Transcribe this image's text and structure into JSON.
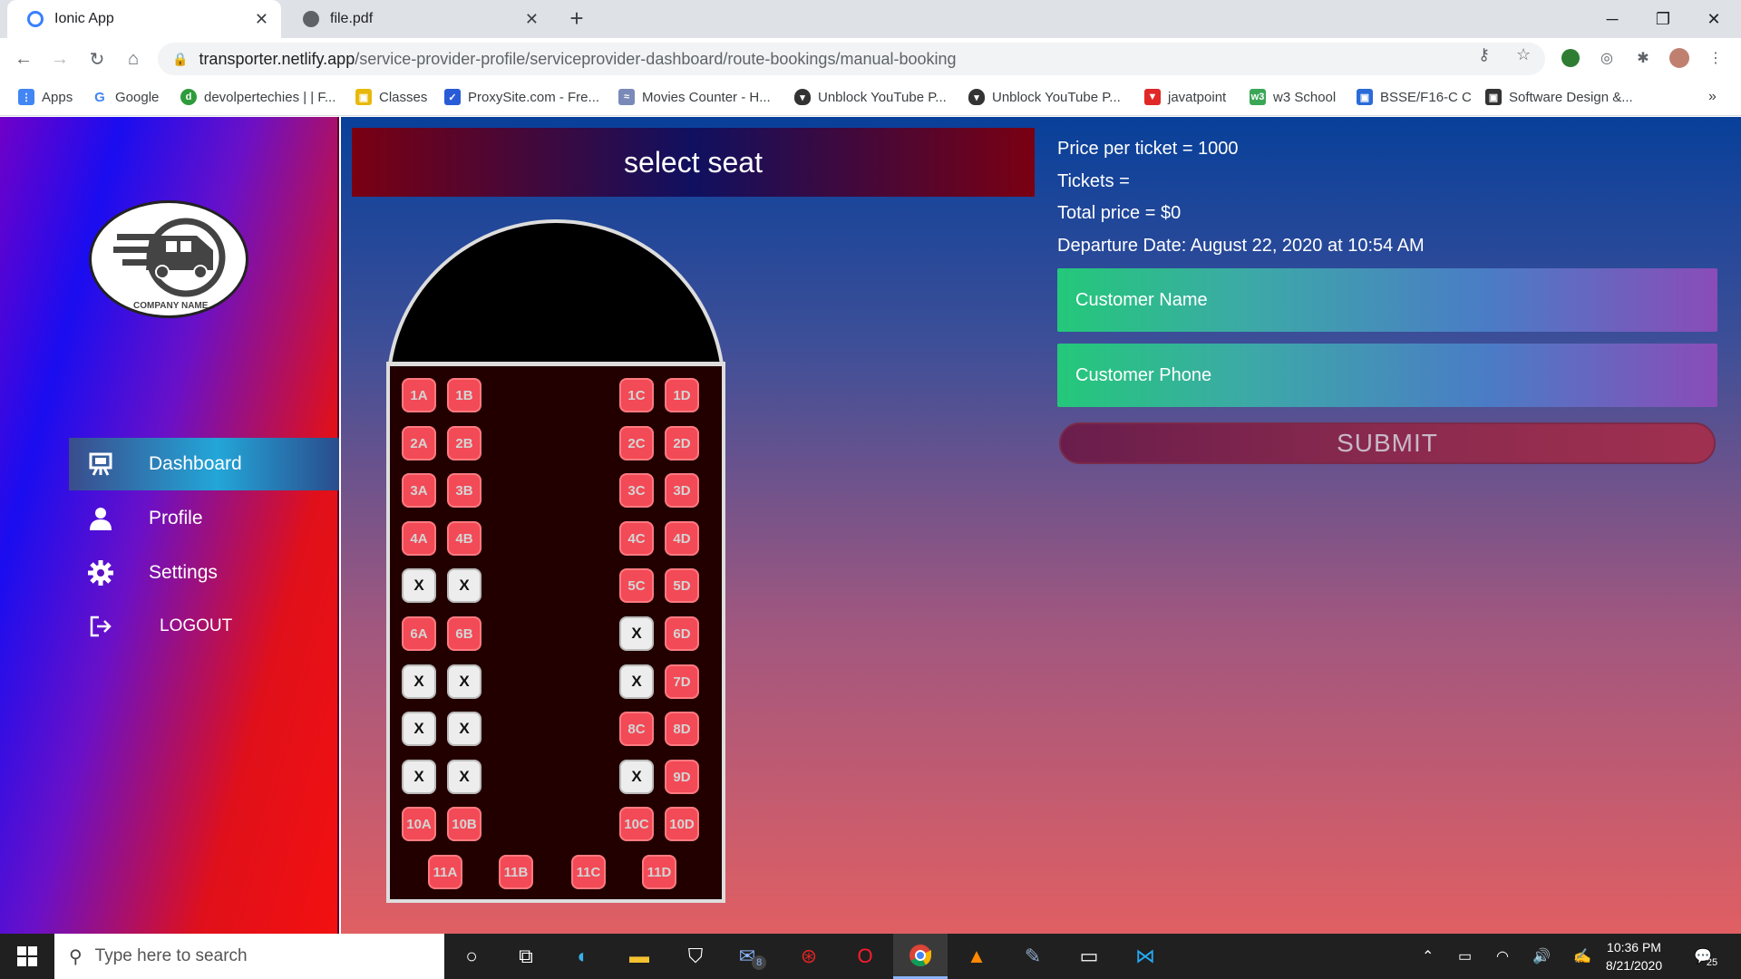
{
  "browser": {
    "tabs": [
      {
        "title": "Ionic App",
        "icon": "ionic-icon"
      },
      {
        "title": "file.pdf",
        "icon": "globe-icon"
      }
    ],
    "url_host": "transporter.netlify.app",
    "url_path": "/service-provider-profile/serviceprovider-dashboard/route-bookings/manual-booking",
    "bookmarks": [
      {
        "label": "Apps",
        "icon": "apps-grid-icon"
      },
      {
        "label": "Google",
        "icon": "google-icon"
      },
      {
        "label": "devolpertechies | | F...",
        "icon": "devolper-icon"
      },
      {
        "label": "Classes",
        "icon": "classes-icon"
      },
      {
        "label": "ProxySite.com - Fre...",
        "icon": "shield-icon"
      },
      {
        "label": "Movies Counter - H...",
        "icon": "movies-icon"
      },
      {
        "label": "Unblock YouTube P...",
        "icon": "shield-icon"
      },
      {
        "label": "Unblock YouTube P...",
        "icon": "shield-icon"
      },
      {
        "label": "javatpoint",
        "icon": "javatpoint-icon"
      },
      {
        "label": "w3 School",
        "icon": "w3-icon"
      },
      {
        "label": "BSSE/F16-C C",
        "icon": "user-icon"
      },
      {
        "label": "Software Design &...",
        "icon": "user-icon"
      }
    ]
  },
  "sidebar": {
    "logo_text": "COMPANY NAME",
    "items": [
      {
        "label": "Dashboard",
        "icon": "easel-icon",
        "active": true
      },
      {
        "label": "Profile",
        "icon": "person-icon",
        "active": false
      },
      {
        "label": "Settings",
        "icon": "gear-icon",
        "active": false
      },
      {
        "label": "LOGOUT",
        "icon": "logout-icon",
        "active": false
      }
    ]
  },
  "main": {
    "header": "select seat",
    "price_per_ticket": "Price per ticket = 1000",
    "tickets": "Tickets =",
    "total_price": "Total price = $0",
    "departure": "Departure Date: August 22, 2020 at 10:54 AM",
    "customer_name_placeholder": "Customer Name",
    "customer_phone_placeholder": "Customer Phone",
    "submit_label": "SUBMIT"
  },
  "seats": {
    "rows": [
      {
        "left": [
          "1A",
          "1B"
        ],
        "right": [
          "1C",
          "1D"
        ]
      },
      {
        "left": [
          "2A",
          "2B"
        ],
        "right": [
          "2C",
          "2D"
        ]
      },
      {
        "left": [
          "3A",
          "3B"
        ],
        "right": [
          "3C",
          "3D"
        ]
      },
      {
        "left": [
          "4A",
          "4B"
        ],
        "right": [
          "4C",
          "4D"
        ]
      },
      {
        "left": [
          "X",
          "X"
        ],
        "right": [
          "5C",
          "5D"
        ]
      },
      {
        "left": [
          "6A",
          "6B"
        ],
        "right": [
          "X",
          "6D"
        ]
      },
      {
        "left": [
          "X",
          "X"
        ],
        "right": [
          "X",
          "7D"
        ]
      },
      {
        "left": [
          "X",
          "X"
        ],
        "right": [
          "8C",
          "8D"
        ]
      },
      {
        "left": [
          "X",
          "X"
        ],
        "right": [
          "X",
          "9D"
        ]
      },
      {
        "left": [
          "10A",
          "10B"
        ],
        "right": [
          "10C",
          "10D"
        ]
      }
    ],
    "back_row": [
      "11A",
      "11B",
      "11C",
      "11D"
    ],
    "taken_marker": "X",
    "colors": {
      "free": "#f24a56",
      "taken": "#ededed"
    }
  },
  "taskbar": {
    "search_placeholder": "Type here to search",
    "time": "10:36 PM",
    "date": "8/21/2020",
    "mail_badge": "8",
    "notification_count": "25"
  }
}
